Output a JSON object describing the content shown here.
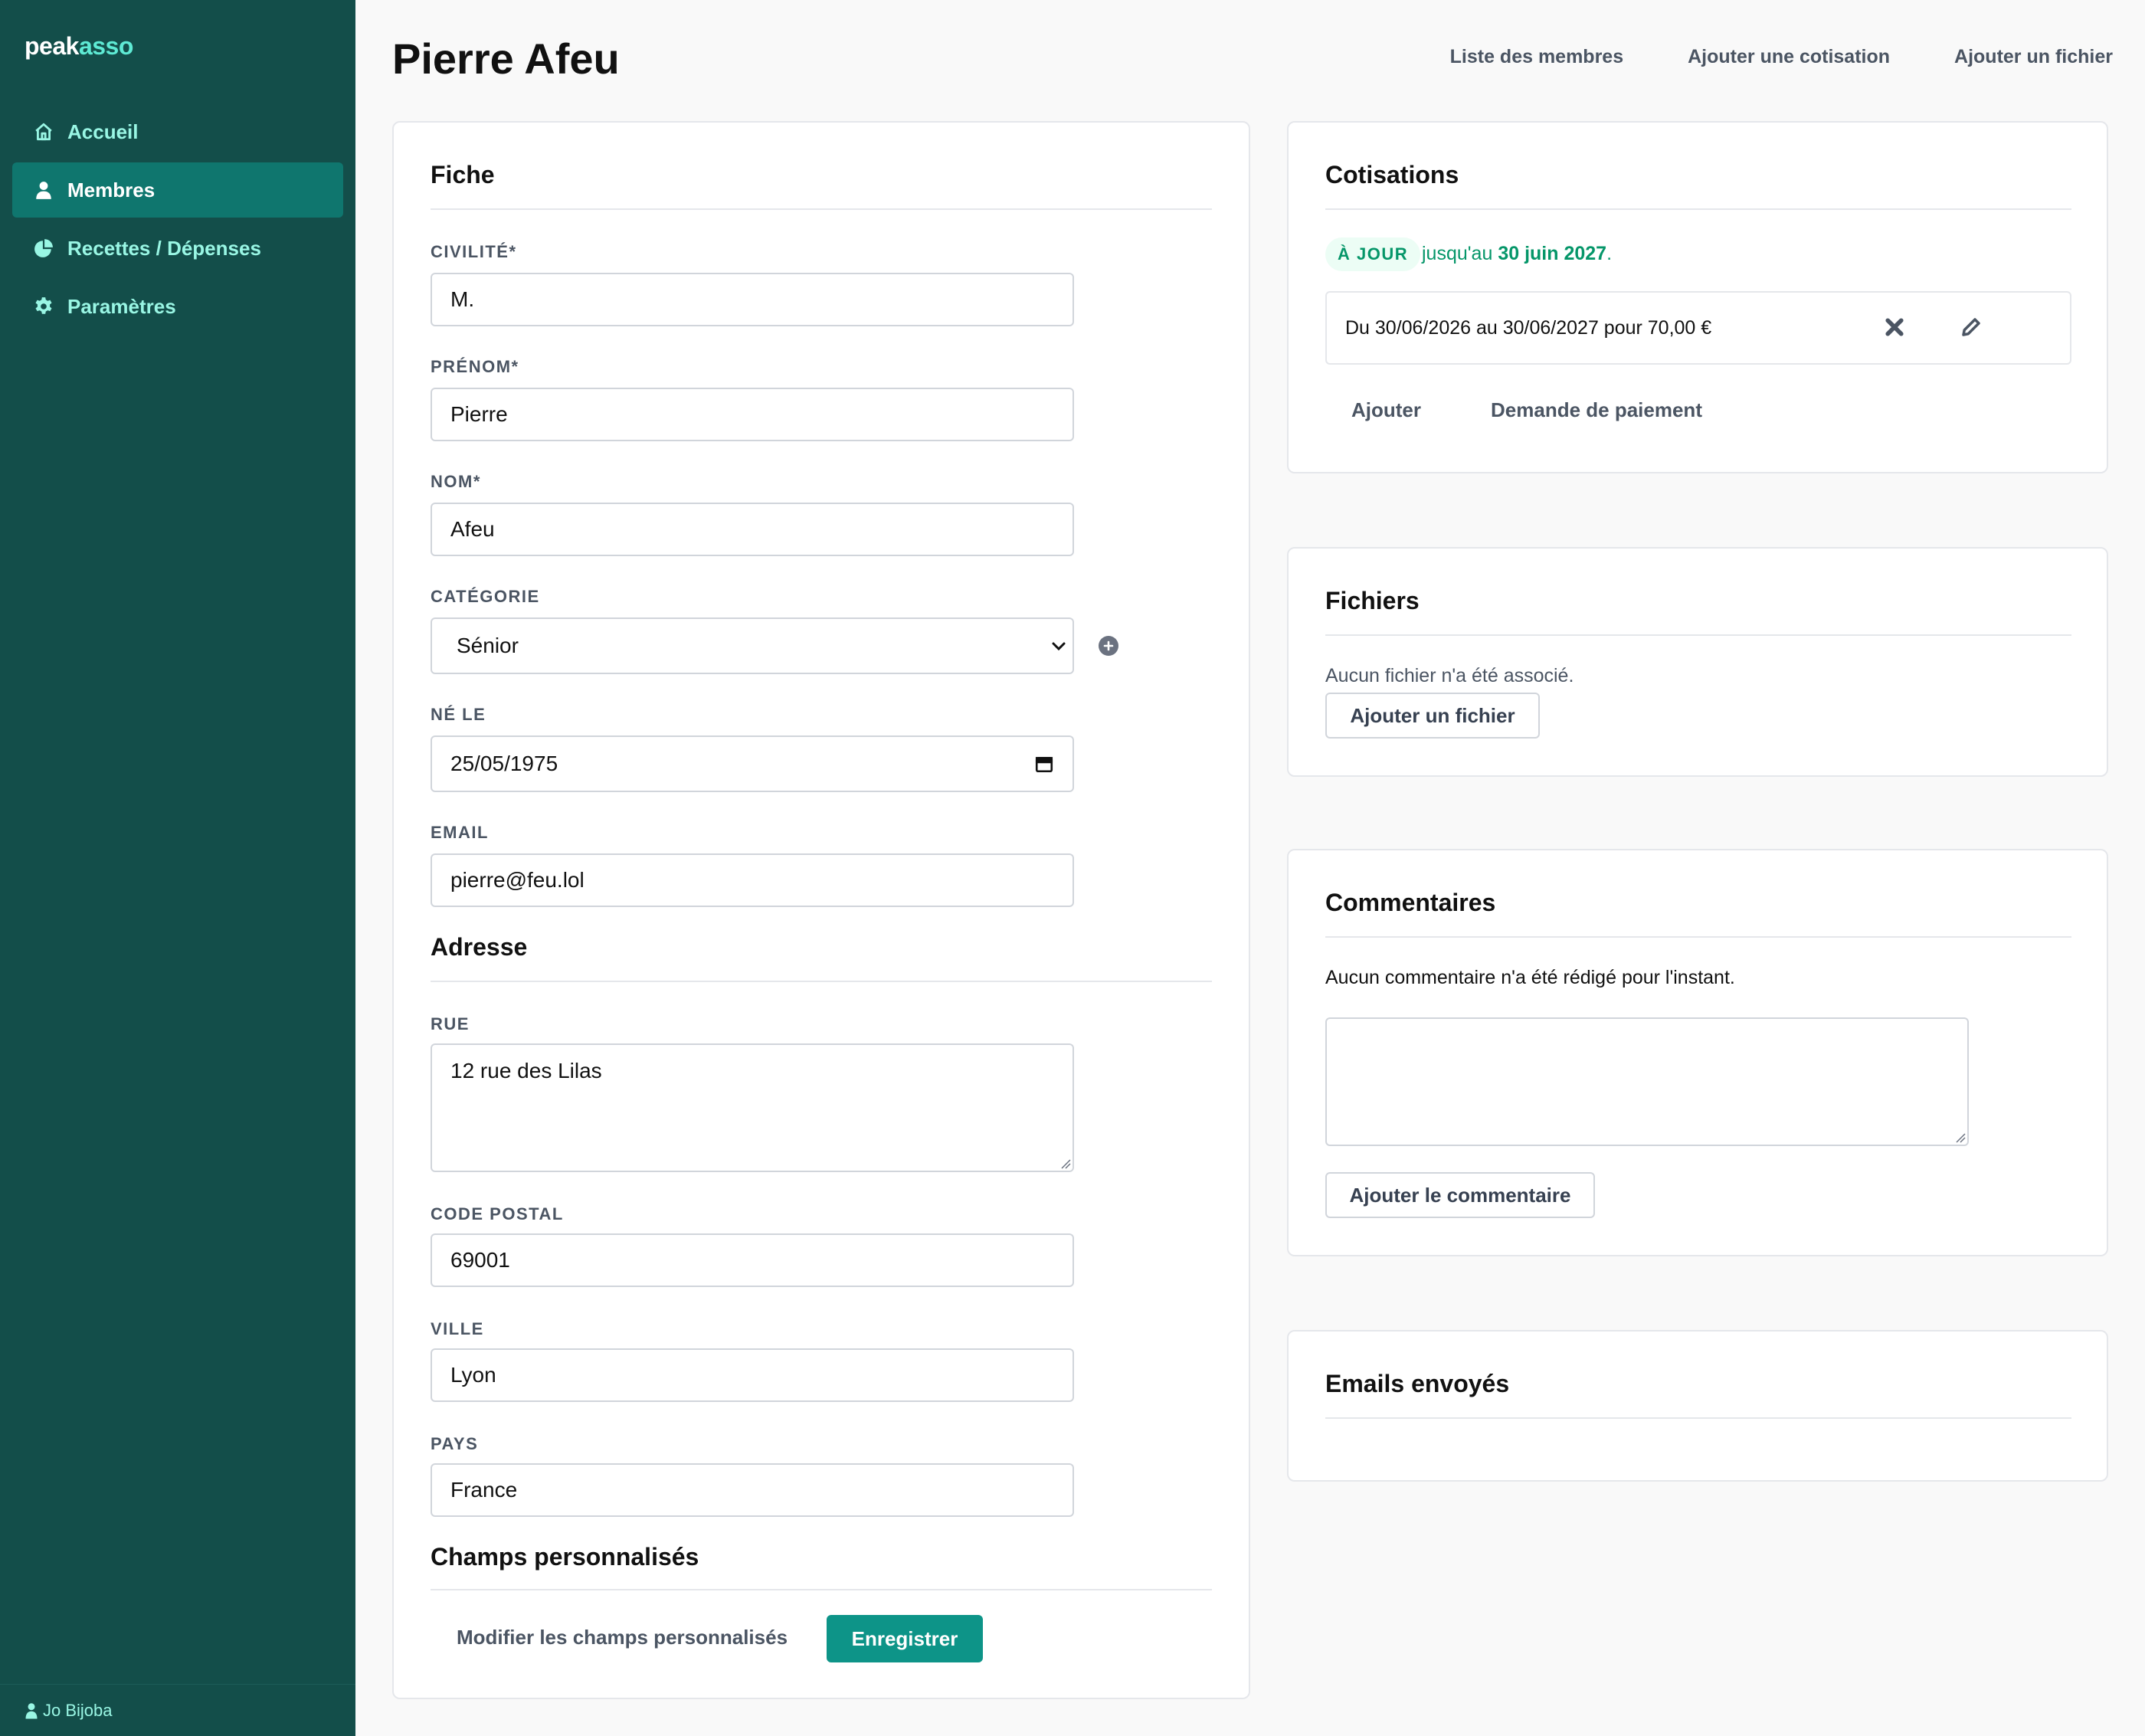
{
  "app": {
    "logo_part1": "peak",
    "logo_part2": "asso"
  },
  "sidebar": {
    "items": [
      {
        "label": "Accueil",
        "icon": "home-icon"
      },
      {
        "label": "Membres",
        "icon": "user-icon",
        "active": true
      },
      {
        "label": "Recettes / Dépenses",
        "icon": "pie-chart-icon"
      },
      {
        "label": "Paramètres",
        "icon": "gear-icon"
      }
    ],
    "user": "Jo Bijoba"
  },
  "header": {
    "title": "Pierre Afeu",
    "links": [
      "Liste des membres",
      "Ajouter une cotisation",
      "Ajouter un fichier"
    ]
  },
  "fiche": {
    "title": "Fiche",
    "fields": {
      "civilite": {
        "label": "CIVILITÉ*",
        "value": "M."
      },
      "prenom": {
        "label": "PRÉNOM*",
        "value": "Pierre"
      },
      "nom": {
        "label": "NOM*",
        "value": "Afeu"
      },
      "categorie": {
        "label": "CATÉGORIE",
        "value": "Sénior"
      },
      "ne_le": {
        "label": "NÉ LE",
        "value": "25/05/1975"
      },
      "email": {
        "label": "EMAIL",
        "value": "pierre@feu.lol"
      }
    },
    "adresse_title": "Adresse",
    "adresse": {
      "rue": {
        "label": "RUE",
        "value": "12 rue des Lilas"
      },
      "code_postal": {
        "label": "CODE POSTAL",
        "value": "69001"
      },
      "ville": {
        "label": "VILLE",
        "value": "Lyon"
      },
      "pays": {
        "label": "PAYS",
        "value": "France"
      }
    },
    "custom_title": "Champs personnalisés",
    "modify_custom_label": "Modifier les champs personnalisés",
    "save_label": "Enregistrer"
  },
  "cotisations": {
    "title": "Cotisations",
    "badge": "À JOUR",
    "status_prefix": "jusqu'au",
    "status_date": "30 juin 2027",
    "status_suffix": ".",
    "entry": "Du 30/06/2026 au 30/06/2027 pour 70,00 €",
    "add_label": "Ajouter",
    "payment_label": "Demande de paiement"
  },
  "fichiers": {
    "title": "Fichiers",
    "empty": "Aucun fichier n'a été associé.",
    "add_label": "Ajouter un fichier"
  },
  "commentaires": {
    "title": "Commentaires",
    "empty": "Aucun commentaire n'a été rédigé pour l'instant.",
    "add_label": "Ajouter le commentaire"
  },
  "emails": {
    "title": "Emails envoyés"
  },
  "colors": {
    "sidebar": "#134e4a",
    "accent": "#0d9488",
    "success": "#059669"
  }
}
